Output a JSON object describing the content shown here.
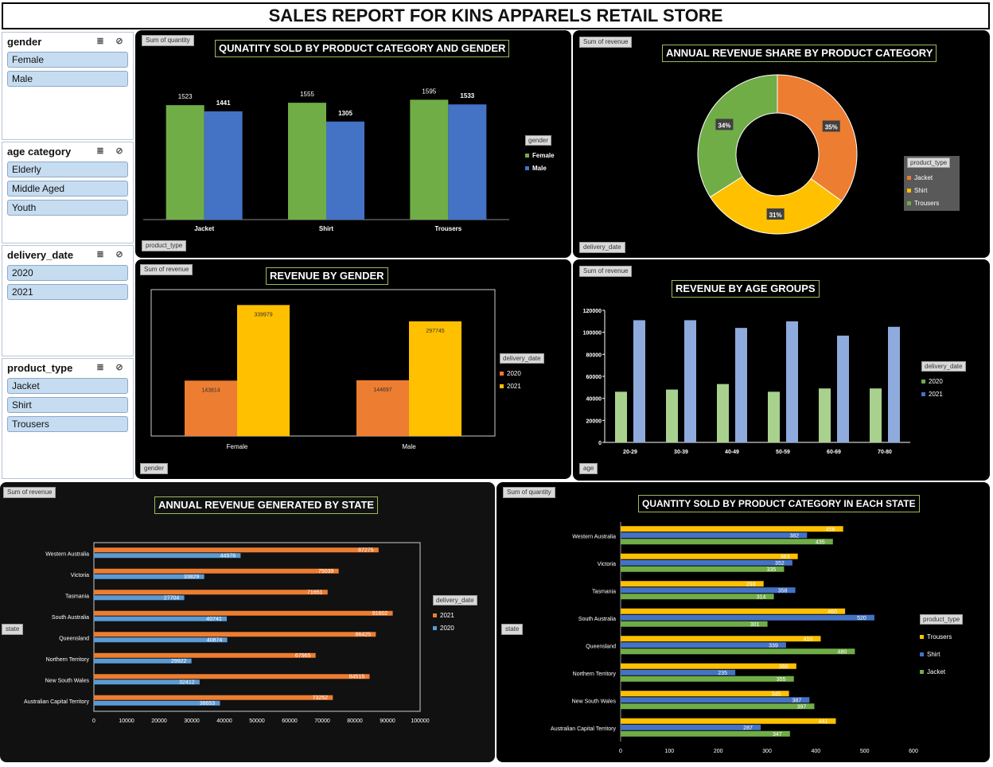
{
  "title": "SALES REPORT FOR KINS APPARELS RETAIL STORE",
  "slicers": [
    {
      "label": "gender",
      "items": [
        "Female",
        "Male"
      ]
    },
    {
      "label": "age category",
      "items": [
        "Elderly",
        "Middle Aged",
        "Youth"
      ]
    },
    {
      "label": "delivery_date",
      "items": [
        "2020",
        "2021"
      ]
    },
    {
      "label": "product_type",
      "items": [
        "Jacket",
        "Shirt",
        "Trousers"
      ]
    }
  ],
  "colors": {
    "green": "#70ad47",
    "blue": "#4472c4",
    "orange": "#ed7d31",
    "gold": "#ffc000",
    "panel": "#000000"
  },
  "panels": {
    "qty_gender": {
      "field": "Sum of quantity",
      "title": "QUNATITY SOLD BY PRODUCT CATEGORY AND GENDER",
      "axis_button": "product_type",
      "legend_button": "gender"
    },
    "rev_share": {
      "field": "Sum of revenue",
      "title": "ANNUAL REVENUE SHARE BY PRODUCT CATEGORY",
      "axis_button": "delivery_date",
      "legend_button": "product_type"
    },
    "rev_gender": {
      "field": "Sum of revenue",
      "title": "REVENUE BY GENDER",
      "axis_button": "gender",
      "legend_button": "delivery_date"
    },
    "rev_age": {
      "field": "Sum of revenue",
      "title": "REVENUE BY AGE GROUPS",
      "axis_button": "age",
      "legend_button": "delivery_date"
    },
    "rev_state": {
      "field": "Sum of revenue",
      "title": "ANNUAL REVENUE GENERATED  BY STATE",
      "axis_button": "state",
      "legend_button": "delivery_date"
    },
    "qty_state": {
      "field": "Sum of quantity",
      "title": "QUANTITY SOLD BY PRODUCT CATEGORY IN EACH STATE",
      "axis_button": "state",
      "legend_button": "product_type"
    }
  },
  "chart_data": [
    {
      "id": "qty_gender",
      "type": "bar",
      "categories": [
        "Jacket",
        "Shirt",
        "Trousers"
      ],
      "series": [
        {
          "name": "Female",
          "values": [
            1523,
            1555,
            1595
          ]
        },
        {
          "name": "Male",
          "values": [
            1441,
            1305,
            1533
          ]
        }
      ],
      "ylim": [
        0,
        1800
      ]
    },
    {
      "id": "rev_share",
      "type": "pie",
      "categories": [
        "Jacket",
        "Shirt",
        "Trousers"
      ],
      "values": [
        35,
        31,
        34
      ],
      "labels": [
        "35%",
        "31%",
        "34%"
      ]
    },
    {
      "id": "rev_gender",
      "type": "bar",
      "categories": [
        "Female",
        "Male"
      ],
      "series": [
        {
          "name": "2020",
          "values": [
            143814,
            144697
          ]
        },
        {
          "name": "2021",
          "values": [
            339979,
            297745
          ]
        }
      ],
      "ylim": [
        0,
        380000
      ]
    },
    {
      "id": "rev_age",
      "type": "bar",
      "categories": [
        "20-29",
        "30-39",
        "40-49",
        "50-59",
        "60-69",
        "70-80"
      ],
      "series": [
        {
          "name": "2020",
          "values": [
            46000,
            48000,
            53000,
            46000,
            49000,
            49000
          ]
        },
        {
          "name": "2021",
          "values": [
            111000,
            111000,
            104000,
            110000,
            97000,
            105000
          ]
        }
      ],
      "ylim": [
        0,
        120000
      ],
      "yticks": [
        "0",
        "20000",
        "40000",
        "60000",
        "80000",
        "100000",
        "120000"
      ]
    },
    {
      "id": "rev_state",
      "type": "bar",
      "orientation": "horizontal",
      "categories": [
        "Western Australia",
        "Victoria",
        "Tasmania",
        "South Australia",
        "Queensland",
        "Northern Territory",
        "New South Wales",
        "Australian Capital Territory"
      ],
      "series": [
        {
          "name": "2021",
          "values": [
            87275,
            75039,
            71651,
            91602,
            86425,
            67965,
            84515,
            73252
          ]
        },
        {
          "name": "2020",
          "values": [
            44976,
            33829,
            27704,
            40741,
            40874,
            29922,
            32412,
            38653
          ]
        }
      ],
      "xlim": [
        0,
        100000
      ],
      "xticks": [
        "0",
        "10000",
        "20000",
        "30000",
        "40000",
        "50000",
        "60000",
        "70000",
        "80000",
        "90000",
        "100000"
      ]
    },
    {
      "id": "qty_state",
      "type": "bar",
      "orientation": "horizontal",
      "categories": [
        "Western Australia",
        "Victoria",
        "Tasmania",
        "South Australia",
        "Queensland",
        "Northern Territory",
        "New South Wales",
        "Australian Capital Territory"
      ],
      "series": [
        {
          "name": "Trousers",
          "values": [
            456,
            363,
            293,
            460,
            410,
            360,
            345,
            441
          ]
        },
        {
          "name": "Shirt",
          "values": [
            382,
            352,
            358,
            520,
            339,
            235,
            387,
            287
          ]
        },
        {
          "name": "Jacket",
          "values": [
            435,
            335,
            314,
            301,
            480,
            355,
            397,
            347
          ]
        }
      ],
      "xlim": [
        0,
        600
      ],
      "xticks": [
        "0",
        "100",
        "200",
        "300",
        "400",
        "500",
        "600"
      ]
    }
  ]
}
